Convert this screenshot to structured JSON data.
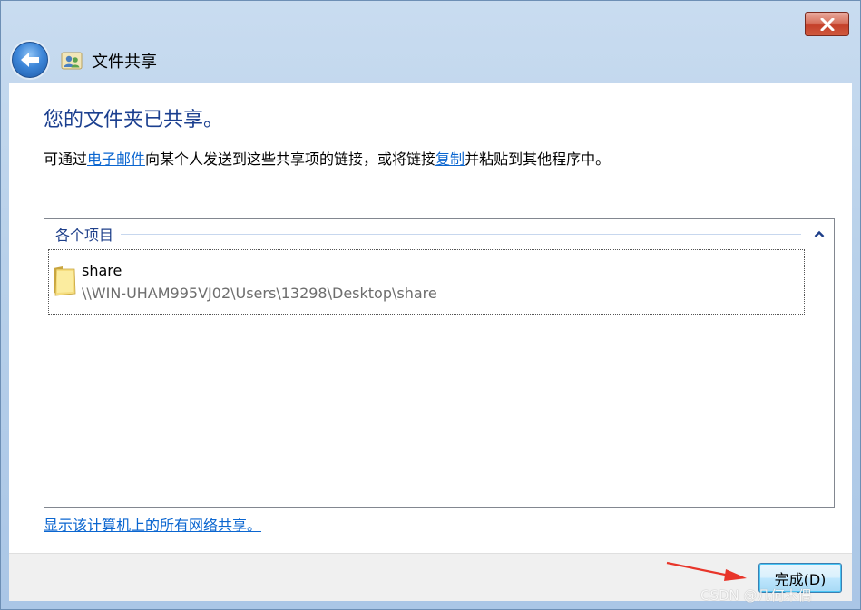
{
  "window": {
    "title": "文件共享"
  },
  "content": {
    "heading": "您的文件夹已共享。",
    "description": {
      "part1": "可通过",
      "email_link": "电子邮件",
      "part2": "向某个人发送到这些共享项的链接，或将链接",
      "copy_link": "复制",
      "part3": "并粘贴到其他程序中。"
    },
    "list": {
      "group_label": "各个项目",
      "items": [
        {
          "name": "share",
          "path": "\\\\WIN-UHAM995VJ02\\Users\\13298\\Desktop\\share",
          "icon": "folder-icon"
        }
      ]
    },
    "show_all_link": "显示该计算机上的所有网络共享。"
  },
  "footer": {
    "finish_label": "完成(D)"
  },
  "watermark": "CSDN @几何木偶",
  "colors": {
    "heading": "#1b3f8f",
    "link": "#0b66d0",
    "path_text": "#6d6d6d",
    "arrow": "#e8352a"
  }
}
